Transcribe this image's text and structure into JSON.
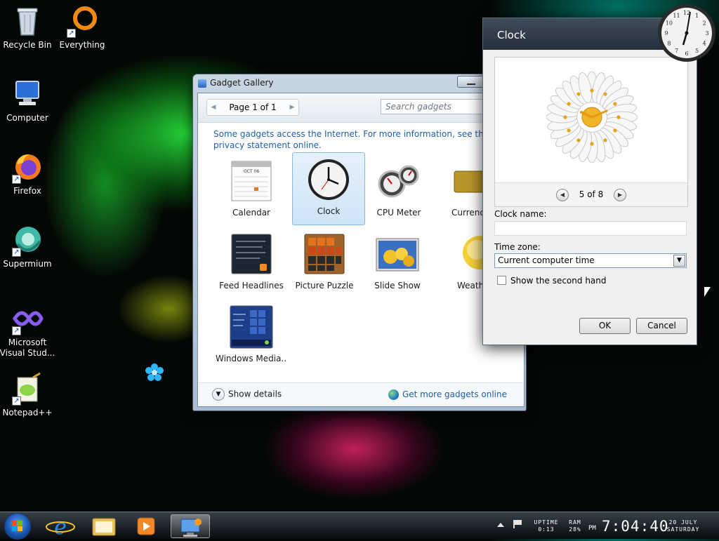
{
  "desktop": {
    "icons": [
      {
        "label": "Recycle Bin"
      },
      {
        "label": "Everything"
      },
      {
        "label": "Computer"
      },
      {
        "label": "Firefox"
      },
      {
        "label": "Supermium"
      },
      {
        "label": "Microsoft Visual Stud..."
      },
      {
        "label": "Notepad++"
      }
    ]
  },
  "gallery": {
    "title": "Gadget Gallery",
    "page_label": "Page 1 of 1",
    "search_placeholder": "Search gadgets",
    "notice": "Some gadgets access the Internet.  For more information, see the privacy statement online.",
    "gadgets": [
      {
        "label": "Calendar",
        "calendar_month": "OCT 06"
      },
      {
        "label": "Clock"
      },
      {
        "label": "CPU Meter"
      },
      {
        "label": "Currency"
      },
      {
        "label": "Feed Headlines"
      },
      {
        "label": "Picture Puzzle"
      },
      {
        "label": "Slide Show"
      },
      {
        "label": "Weather"
      },
      {
        "label": "Windows Media..."
      }
    ],
    "show_details": "Show details",
    "get_more": "Get more gadgets online"
  },
  "clock_dialog": {
    "title": "Clock",
    "nav_label": "5 of 8",
    "clock_name_label": "Clock name:",
    "clock_name_value": "",
    "time_zone_label": "Time zone:",
    "time_zone_value": "Current computer time",
    "second_hand_label": "Show the second hand",
    "second_hand_checked": false,
    "ok_label": "OK",
    "cancel_label": "Cancel"
  },
  "taskbar": {
    "uptime_label": "UPTIME",
    "uptime_value": "0:13",
    "ram_label": "RAM",
    "ram_value": "28%",
    "ampm": "PM",
    "time": "7:04:40",
    "date": "20 JULY",
    "weekday": "SATURDAY"
  },
  "colors": {
    "link_blue": "#1f5fa8",
    "selection_bg": "#cfe4f7",
    "dialog_header": "#2c3946"
  }
}
